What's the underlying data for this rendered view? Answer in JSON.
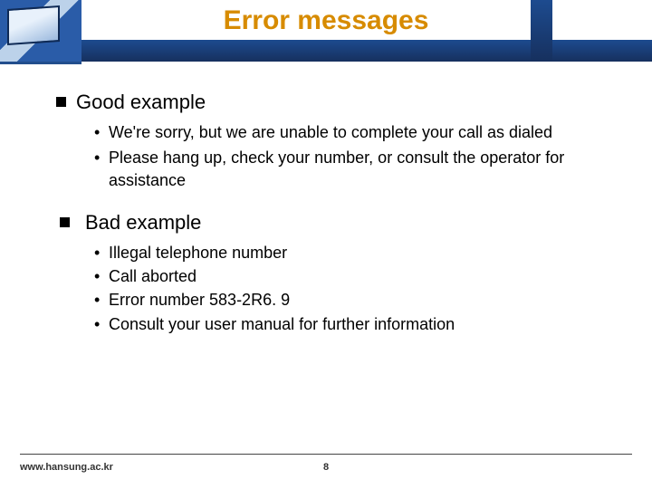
{
  "title": "Error messages",
  "sections": {
    "good": {
      "heading": "Good example",
      "items": [
        " We're sorry, but we are unable to complete your call as dialed",
        "Please hang  up, check your number, or consult the operator for assistance"
      ]
    },
    "bad": {
      "heading": " Bad example",
      "items": [
        "Illegal telephone number",
        "Call aborted",
        "Error number 583-2R6. 9",
        "Consult your user manual for further information"
      ]
    }
  },
  "footer": {
    "url": "www.hansung.ac.kr",
    "page": "8"
  }
}
